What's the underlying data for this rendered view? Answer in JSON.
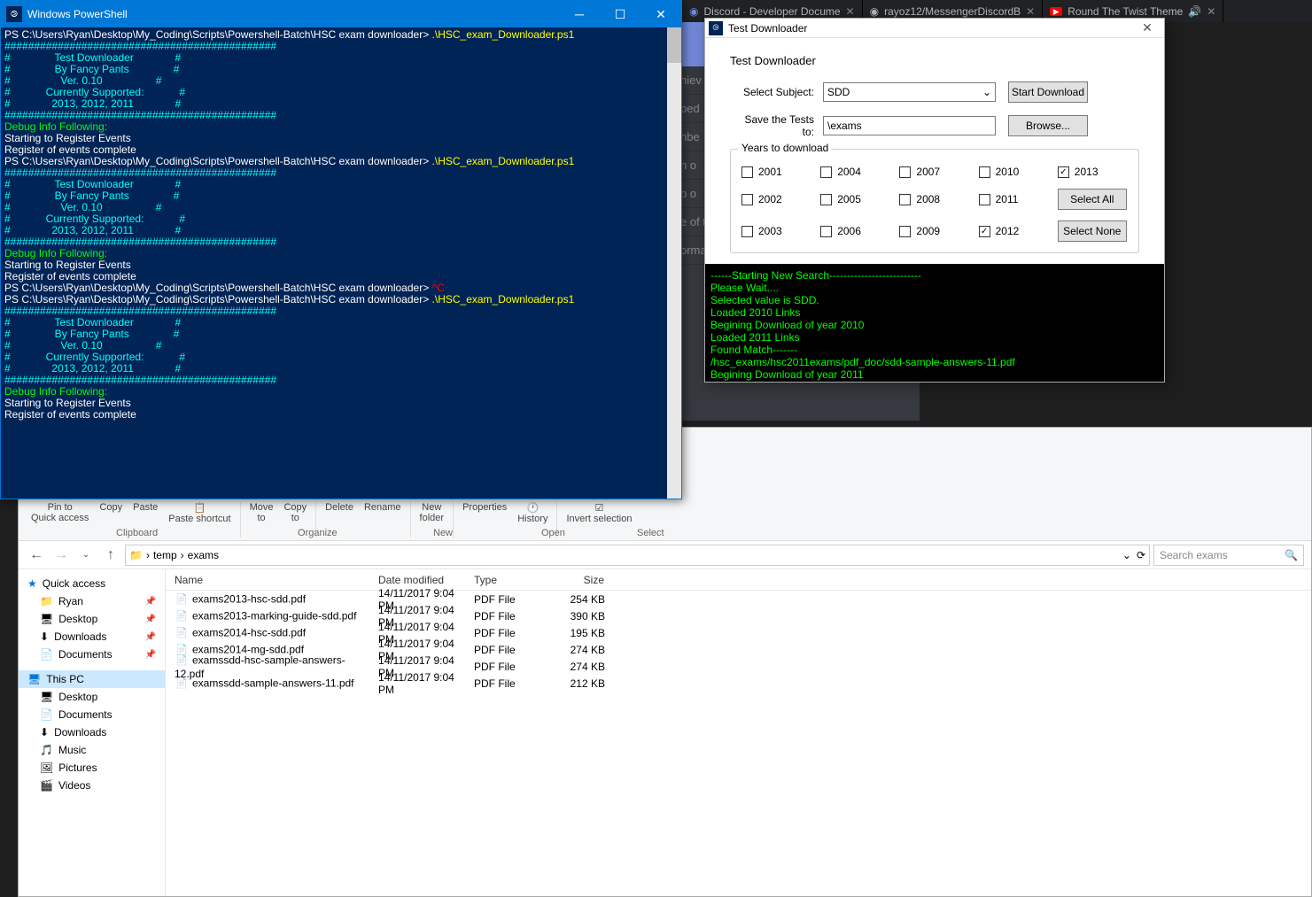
{
  "browser": {
    "tabs": [
      {
        "label": "Discord - Developer Docume",
        "favicon": "discord"
      },
      {
        "label": "rayoz12/MessengerDiscordB",
        "favicon": "github"
      },
      {
        "label": "Round The Twist Theme",
        "favicon": "youtube",
        "audio": true
      }
    ]
  },
  "discord": {
    "rows": [
      "hiev",
      "bed",
      "nbe",
      "n o",
      "p o",
      "e of the embed",
      "ormation"
    ]
  },
  "powershell": {
    "title": "Windows PowerShell",
    "lines": [
      {
        "t": "PS C:\\Users\\Ryan\\Desktop\\My_Coding\\Scripts\\Powershell-Batch\\HSC exam downloader> ",
        "c": "white",
        "suffix": ".\\HSC_exam_Downloader.ps1",
        "sc": "yellow"
      },
      {
        "t": "##############################################",
        "c": "cyan"
      },
      {
        "t": "#               Test Downloader              #",
        "c": "cyan"
      },
      {
        "t": "#               By Fancy Pants               #",
        "c": "cyan"
      },
      {
        "t": "#                 Ver. 0.10                  #",
        "c": "cyan"
      },
      {
        "t": "#            Currently Supported:            #",
        "c": "cyan"
      },
      {
        "t": "#              2013, 2012, 2011              #",
        "c": "cyan"
      },
      {
        "t": "##############################################",
        "c": "cyan"
      },
      {
        "t": "Debug Info Following:",
        "c": "green"
      },
      {
        "t": "Starting to Register Events",
        "c": "white"
      },
      {
        "t": "Register of events complete",
        "c": "white"
      },
      {
        "t": "PS C:\\Users\\Ryan\\Desktop\\My_Coding\\Scripts\\Powershell-Batch\\HSC exam downloader> ",
        "c": "white",
        "suffix": ".\\HSC_exam_Downloader.ps1",
        "sc": "yellow"
      },
      {
        "t": "##############################################",
        "c": "cyan"
      },
      {
        "t": "#               Test Downloader              #",
        "c": "cyan"
      },
      {
        "t": "#               By Fancy Pants               #",
        "c": "cyan"
      },
      {
        "t": "#                 Ver. 0.10                  #",
        "c": "cyan"
      },
      {
        "t": "#            Currently Supported:            #",
        "c": "cyan"
      },
      {
        "t": "#              2013, 2012, 2011              #",
        "c": "cyan"
      },
      {
        "t": "##############################################",
        "c": "cyan"
      },
      {
        "t": "Debug Info Following:",
        "c": "green"
      },
      {
        "t": "Starting to Register Events",
        "c": "white"
      },
      {
        "t": "Register of events complete",
        "c": "white"
      },
      {
        "t": "PS C:\\Users\\Ryan\\Desktop\\My_Coding\\Scripts\\Powershell-Batch\\HSC exam downloader> ",
        "c": "white",
        "suffix": "^C",
        "sc": "red"
      },
      {
        "t": "PS C:\\Users\\Ryan\\Desktop\\My_Coding\\Scripts\\Powershell-Batch\\HSC exam downloader> ",
        "c": "white",
        "suffix": ".\\HSC_exam_Downloader.ps1",
        "sc": "yellow"
      },
      {
        "t": "##############################################",
        "c": "cyan"
      },
      {
        "t": "#               Test Downloader              #",
        "c": "cyan"
      },
      {
        "t": "#               By Fancy Pants               #",
        "c": "cyan"
      },
      {
        "t": "#                 Ver. 0.10                  #",
        "c": "cyan"
      },
      {
        "t": "#            Currently Supported:            #",
        "c": "cyan"
      },
      {
        "t": "#              2013, 2012, 2011              #",
        "c": "cyan"
      },
      {
        "t": "##############################################",
        "c": "cyan"
      },
      {
        "t": "Debug Info Following:",
        "c": "green"
      },
      {
        "t": "Starting to Register Events",
        "c": "white"
      },
      {
        "t": "Register of events complete",
        "c": "white"
      }
    ]
  },
  "downloader": {
    "title": "Test Downloader",
    "heading": "Test Downloader",
    "subject_label": "Select Subject:",
    "subject_value": "SDD",
    "start_button": "Start Download",
    "save_label": "Save the Tests to:",
    "save_value": "\\exams",
    "browse_button": "Browse...",
    "years_legend": "Years to download",
    "years": [
      {
        "y": "2001",
        "checked": false
      },
      {
        "y": "2004",
        "checked": false
      },
      {
        "y": "2007",
        "checked": false
      },
      {
        "y": "2010",
        "checked": false
      },
      {
        "y": "2013",
        "checked": true
      },
      {
        "y": "2002",
        "checked": false
      },
      {
        "y": "2005",
        "checked": false
      },
      {
        "y": "2008",
        "checked": false
      },
      {
        "y": "2011",
        "checked": false
      },
      {
        "y": "Select All",
        "btn": true
      },
      {
        "y": "2003",
        "checked": false
      },
      {
        "y": "2006",
        "checked": false
      },
      {
        "y": "2009",
        "checked": false
      },
      {
        "y": "2012",
        "checked": true
      },
      {
        "y": "Select None",
        "btn": true
      }
    ],
    "console": [
      "------Starting New Search--------------------------",
      "Please Wait....",
      "Selected value is SDD.",
      "Loaded 2010 Links",
      "Begining Download of year 2010",
      "Loaded 2011 Links",
      "Found Match-------",
      "/hsc_exams/hsc2011exams/pdf_doc/sdd-sample-answers-11.pdf",
      "Begining Download of year 2011"
    ]
  },
  "explorer": {
    "ribbon": {
      "items": [
        "Pin to Quick access",
        "Copy",
        "Paste",
        "Paste shortcut",
        "Move to",
        "Copy to",
        "Delete",
        "Rename",
        "New folder",
        "Properties",
        "History",
        "Invert selection"
      ],
      "groups": [
        "Clipboard",
        "Organize",
        "New",
        "Open",
        "Select"
      ]
    },
    "path": [
      "temp",
      "exams"
    ],
    "search_placeholder": "Search exams",
    "sidebar": {
      "quick_access": "Quick access",
      "quick_items": [
        "Ryan",
        "Desktop",
        "Downloads",
        "Documents"
      ],
      "this_pc": "This PC",
      "pc_items": [
        "Desktop",
        "Documents",
        "Downloads",
        "Music",
        "Pictures",
        "Videos"
      ]
    },
    "columns": [
      "Name",
      "Date modified",
      "Type",
      "Size"
    ],
    "files": [
      {
        "name": "exams2013-hsc-sdd.pdf",
        "date": "14/11/2017 9:04 PM",
        "type": "PDF File",
        "size": "254 KB"
      },
      {
        "name": "exams2013-marking-guide-sdd.pdf",
        "date": "14/11/2017 9:04 PM",
        "type": "PDF File",
        "size": "390 KB"
      },
      {
        "name": "exams2014-hsc-sdd.pdf",
        "date": "14/11/2017 9:04 PM",
        "type": "PDF File",
        "size": "195 KB"
      },
      {
        "name": "exams2014-mg-sdd.pdf",
        "date": "14/11/2017 9:04 PM",
        "type": "PDF File",
        "size": "274 KB"
      },
      {
        "name": "examssdd-hsc-sample-answers-12.pdf",
        "date": "14/11/2017 9:04 PM",
        "type": "PDF File",
        "size": "274 KB"
      },
      {
        "name": "examssdd-sample-answers-11.pdf",
        "date": "14/11/2017 9:04 PM",
        "type": "PDF File",
        "size": "212 KB"
      }
    ]
  }
}
